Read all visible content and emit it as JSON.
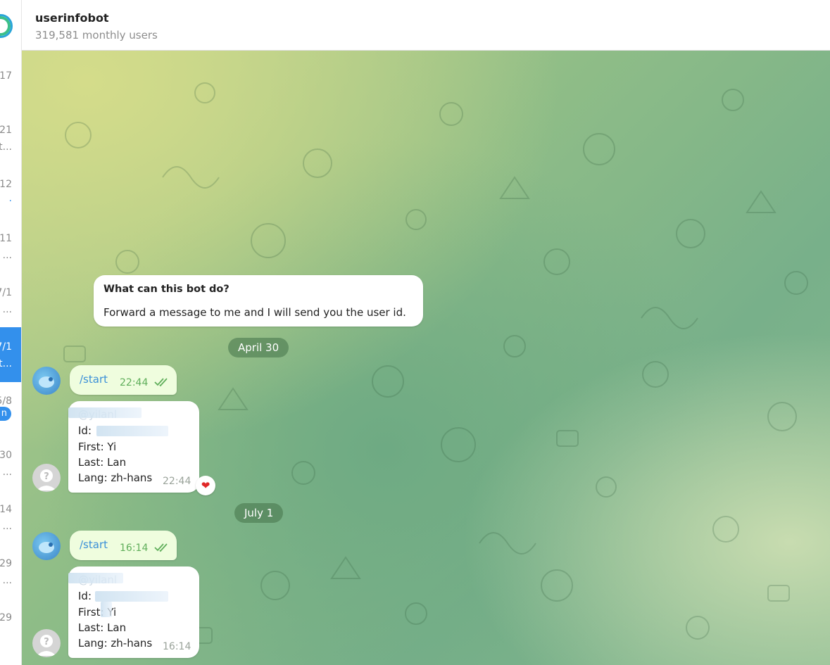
{
  "chat": {
    "title": "userinfobot",
    "subtitle": "319,581 monthly users"
  },
  "sidebar": {
    "items": [
      {
        "time": "17",
        "sub": ""
      },
      {
        "time": "21",
        "sub": "t..."
      },
      {
        "time": "12",
        "sub": "·"
      },
      {
        "time": "11",
        "sub": "..."
      },
      {
        "time": "7/1",
        "sub": "..."
      },
      {
        "time": "7/1",
        "sub": "t..."
      },
      {
        "time": "5/8",
        "sub": "n"
      },
      {
        "time": "30",
        "sub": "..."
      },
      {
        "time": "14",
        "sub": "..."
      },
      {
        "time": "29",
        "sub": "..."
      },
      {
        "time": "29",
        "sub": ""
      }
    ]
  },
  "intro": {
    "title": "What can this bot do?",
    "body": "Forward a message to me and I will send you the user id."
  },
  "dates": {
    "first": "April 30",
    "second": "July 1"
  },
  "messages": {
    "out1": {
      "text": "/start",
      "time": "22:44"
    },
    "in1": {
      "handle": "@yilanl",
      "id": "Id:",
      "first": "First: Yi",
      "last": "Last: Lan",
      "lang": "Lang: zh-hans",
      "time": "22:44",
      "reaction": "❤"
    },
    "out2": {
      "text": "/start",
      "time": "16:14"
    },
    "in2": {
      "handle": "@yilanl",
      "id": "Id:",
      "first": "First: Yi",
      "last": "Last: Lan",
      "lang": "Lang: zh-hans",
      "time": "16:14"
    }
  },
  "colors": {
    "accent": "#3390ec",
    "outgoing_bubble": "#effdde",
    "link": "#3a8fd8"
  }
}
